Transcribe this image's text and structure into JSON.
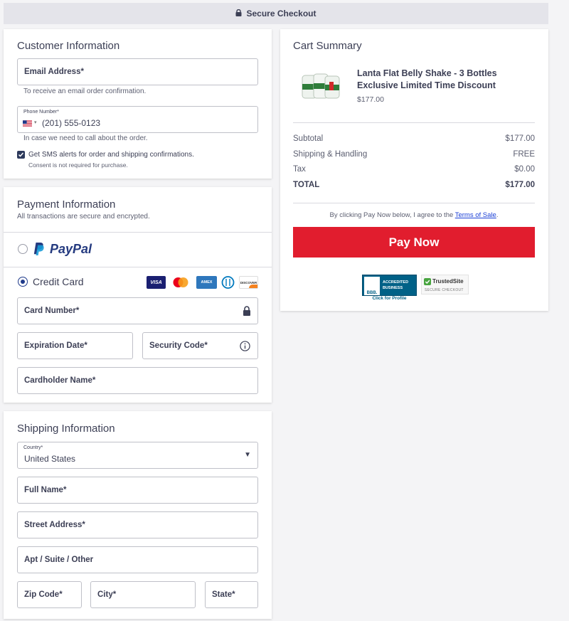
{
  "topbar": {
    "title": "Secure Checkout"
  },
  "customer": {
    "title": "Customer Information",
    "email_label": "Email Address*",
    "email_hint": "To receive an email order confirmation.",
    "phone_label": "Phone Number*",
    "phone_value": "(201) 555-0123",
    "phone_hint": "In case we need to call about the order.",
    "sms_label": "Get SMS alerts for order and shipping confirmations.",
    "sms_consent": "Consent is not required for purchase."
  },
  "payment": {
    "title": "Payment Information",
    "subtitle": "All transactions are secure and encrypted.",
    "paypal_label": "PayPal",
    "credit_label": "Credit Card",
    "card_brands": [
      "VISA",
      "AMEX",
      "DISCOVER"
    ],
    "card_number_label": "Card Number*",
    "expiration_label": "Expiration Date*",
    "security_label": "Security Code*",
    "cardholder_label": "Cardholder Name*"
  },
  "shipping": {
    "title": "Shipping Information",
    "country_label": "Country*",
    "country_value": "United States",
    "fullname_label": "Full Name*",
    "street_label": "Street Address*",
    "apt_label": "Apt / Suite / Other",
    "zip_label": "Zip Code*",
    "city_label": "City*",
    "state_label": "State*"
  },
  "cart": {
    "title": "Cart Summary",
    "product_name": "Lanta Flat Belly Shake - 3 Bottles Exclusive Limited Time Discount",
    "product_price": "$177.00",
    "subtotal_label": "Subtotal",
    "subtotal_value": "$177.00",
    "shipping_label": "Shipping & Handling",
    "shipping_value": "FREE",
    "tax_label": "Tax",
    "tax_value": "$0.00",
    "total_label": "TOTAL",
    "total_value": "$177.00",
    "terms_prefix": "By clicking Pay Now below, I agree to the",
    "terms_link": "Terms of Sale",
    "terms_suffix": ".",
    "pay_button": "Pay Now",
    "bbb_line1": "ACCREDITED",
    "bbb_line2": "BUSINESS",
    "bbb_brand": "BBB.",
    "bbb_profile": "Click for Profile",
    "trusted_title": "TrustedSite",
    "trusted_sub": "SECURE CHECKOUT"
  },
  "colors": {
    "pay_red": "#e11d2e",
    "accent_blue": "#1f3a8a",
    "paypal_dark": "#253b80",
    "paypal_light": "#179bd7"
  }
}
